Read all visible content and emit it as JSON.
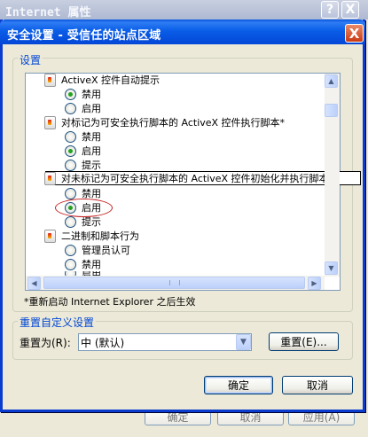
{
  "background_window": {
    "title": "Internet 属性",
    "help_label": "?",
    "close_label": "X",
    "buttons": {
      "ok": "确定",
      "cancel": "取消",
      "apply": "应用(A)"
    }
  },
  "dialog": {
    "title": "安全设置 - 受信任的站点区域",
    "close_label": "X",
    "settings_group_label": "设置",
    "settings": [
      {
        "category": "ActiveX 控件自动提示",
        "options": [
          {
            "label": "禁用",
            "selected": true
          },
          {
            "label": "启用",
            "selected": false
          }
        ]
      },
      {
        "category": "对标记为可安全执行脚本的 ActiveX 控件执行脚本*",
        "options": [
          {
            "label": "禁用",
            "selected": false
          },
          {
            "label": "启用",
            "selected": true
          },
          {
            "label": "提示",
            "selected": false
          }
        ]
      },
      {
        "category": "对未标记为可安全执行脚本的 ActiveX 控件初始化并执行脚本",
        "options": [
          {
            "label": "禁用",
            "selected": false
          },
          {
            "label": "启用",
            "selected": true
          },
          {
            "label": "提示",
            "selected": false
          }
        ]
      },
      {
        "category": "二进制和脚本行为",
        "options": [
          {
            "label": "管理员认可",
            "selected": false
          },
          {
            "label": "禁用",
            "selected": false
          },
          {
            "label": "启用",
            "selected": false
          }
        ]
      }
    ],
    "restart_note": "*重新启动 Internet Explorer 之后生效",
    "reset_group_label": "重置自定义设置",
    "reset_to_label": "重置为(R):",
    "reset_level_value": "中 (默认)",
    "reset_button": "重置(E)...",
    "ok_button": "确定",
    "cancel_button": "取消"
  },
  "colors": {
    "titlebar": "#0a56e0",
    "group_label": "#0046d5",
    "annotation": "#c41e1e",
    "selected_radio": "#21a121"
  }
}
